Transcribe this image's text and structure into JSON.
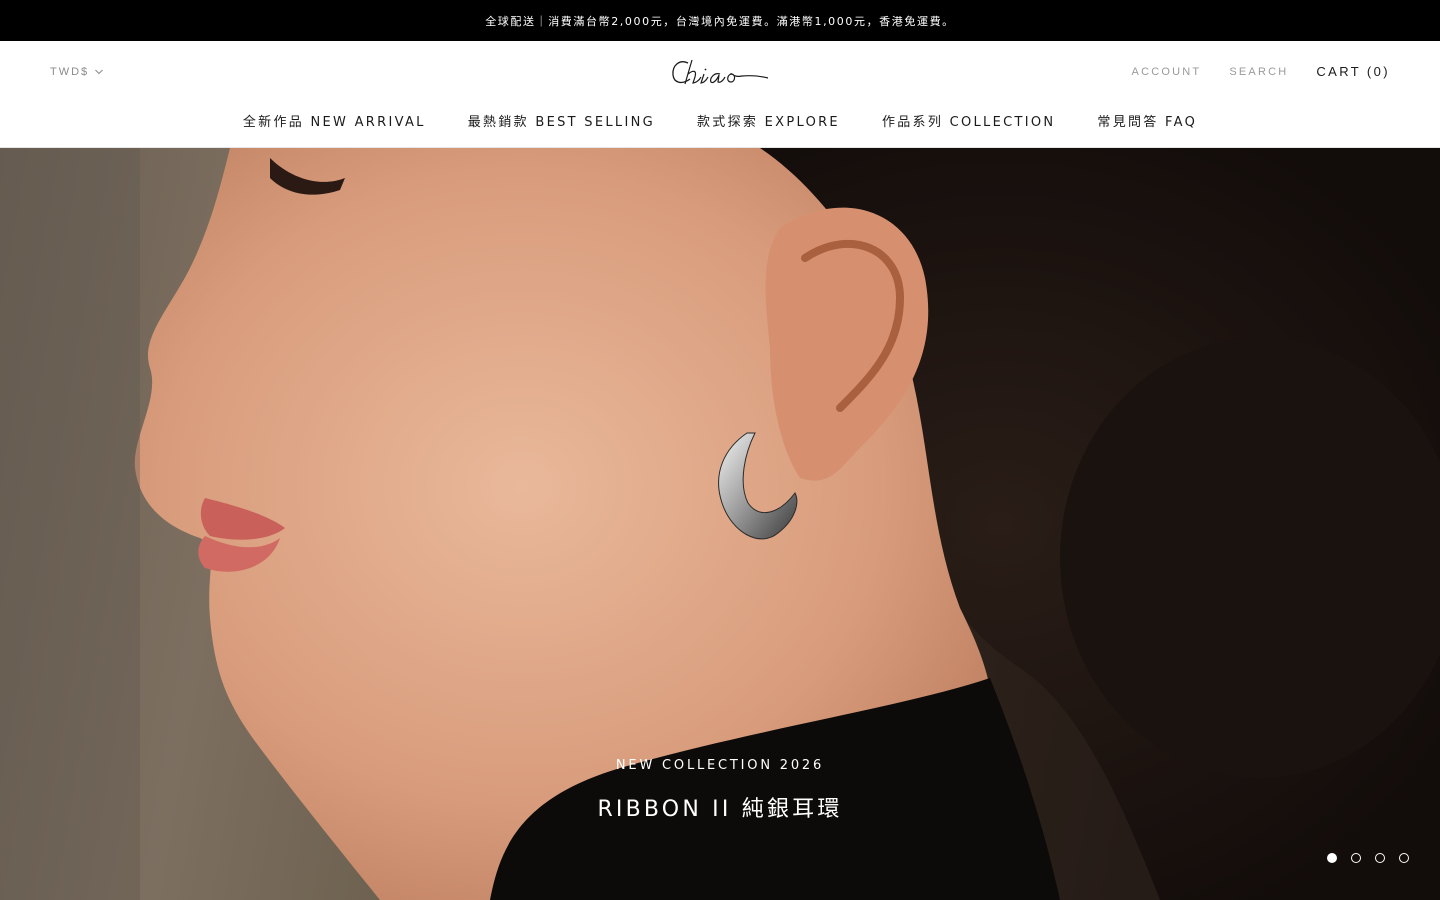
{
  "announcement": {
    "text": "全球配送｜消費滿台幣2,000元，台灣境內免運費。滿港幣1,000元，香港免運費。"
  },
  "header": {
    "currency": {
      "selected": "TWD$"
    },
    "logo_text": "Chiao",
    "account_label": "ACCOUNT",
    "search_label": "SEARCH",
    "cart_label": "CART (0)"
  },
  "nav": {
    "items": [
      {
        "label": "全新作品 NEW ARRIVAL"
      },
      {
        "label": "最熱銷款 BEST SELLING"
      },
      {
        "label": "款式探索 EXPLORE"
      },
      {
        "label": "作品系列 COLLECTION"
      },
      {
        "label": "常見問答 FAQ"
      }
    ]
  },
  "hero": {
    "subtitle": "NEW COLLECTION 2026",
    "title": "RIBBON II 純銀耳環",
    "slides_count": 4,
    "active_slide": 1
  },
  "colors": {
    "announcement_bg": "#000000",
    "text_dark": "#1c1b1b",
    "text_light": "#9a9a9a",
    "hero_text": "#ffffff"
  }
}
